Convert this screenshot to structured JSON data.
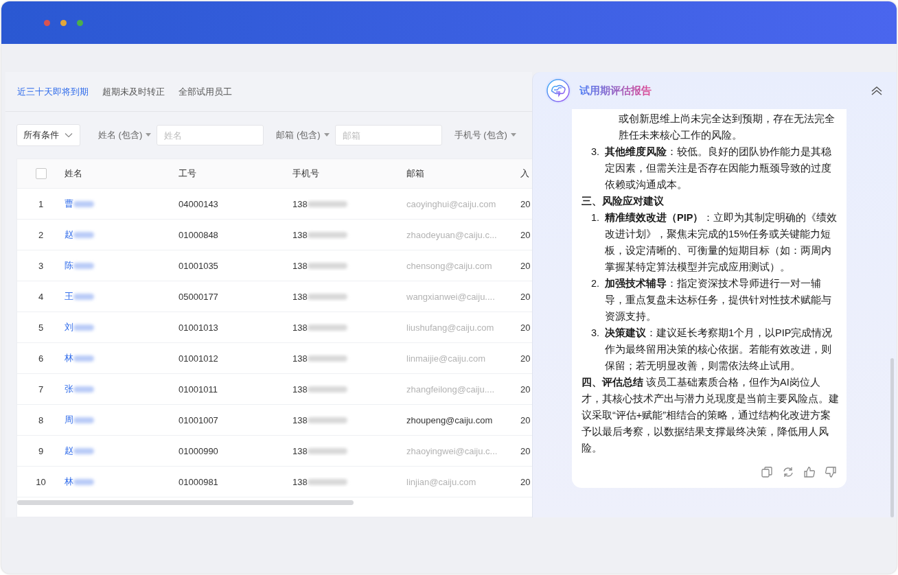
{
  "tabs": [
    {
      "label": "近三十天即将到期",
      "selected": true
    },
    {
      "label": "超期未及时转正",
      "selected": false
    },
    {
      "label": "全部试用员工",
      "selected": false
    }
  ],
  "filters": {
    "condition": "所有条件",
    "fields": [
      {
        "label": "姓名 (包含)",
        "placeholder": "姓名"
      },
      {
        "label": "邮箱 (包含)",
        "placeholder": "邮箱"
      },
      {
        "label": "手机号 (包含)"
      }
    ]
  },
  "table": {
    "select_all_checked": false,
    "columns": [
      "姓名",
      "工号",
      "手机号",
      "邮箱",
      "入"
    ],
    "rows": [
      {
        "index": "1",
        "name": "曹",
        "name_masked": true,
        "id": "04000143",
        "phone": "138",
        "phone_masked": true,
        "email": "caoyinghui@caiju.com",
        "email_masked": true,
        "column_5": "20"
      },
      {
        "index": "2",
        "name": "赵",
        "name_masked": true,
        "id": "01000848",
        "phone": "138",
        "phone_masked": true,
        "email": "zhaodeyuan@caiju.c...",
        "email_masked": true,
        "column_5": "20"
      },
      {
        "index": "3",
        "name": "陈",
        "name_masked": true,
        "id": "01001035",
        "phone": "138",
        "phone_masked": true,
        "email": "chensong@caiju.com",
        "email_masked": true,
        "column_5": "20"
      },
      {
        "index": "4",
        "name": "王",
        "name_masked": true,
        "id": "05000177",
        "phone": "138",
        "phone_masked": true,
        "email": "wangxianwei@caiju....",
        "email_masked": true,
        "column_5": "20"
      },
      {
        "index": "5",
        "name": "刘",
        "name_masked": true,
        "id": "01001013",
        "phone": "138",
        "phone_masked": true,
        "email": "liushufang@caiju.com",
        "email_masked": true,
        "column_5": "20"
      },
      {
        "index": "6",
        "name": "林",
        "name_masked": true,
        "id": "01001012",
        "phone": "138",
        "phone_masked": true,
        "email": "linmaijie@caiju.com",
        "email_masked": true,
        "column_5": "20"
      },
      {
        "index": "7",
        "name": "张",
        "name_masked": true,
        "id": "01001011",
        "phone": "138",
        "phone_masked": true,
        "email": "zhangfeilong@caiju....",
        "email_masked": true,
        "column_5": "20"
      },
      {
        "index": "8",
        "name": "周",
        "name_masked": true,
        "id": "01001007",
        "phone": "138",
        "phone_masked": true,
        "email": "zhoupeng@caiju.com",
        "email_masked": false,
        "column_5": "20"
      },
      {
        "index": "9",
        "name": "赵",
        "name_masked": true,
        "id": "01000990",
        "phone": "138",
        "phone_masked": true,
        "email": "zhaoyingwei@caiju.c...",
        "email_masked": true,
        "column_5": "20"
      },
      {
        "index": "10",
        "name": "林",
        "name_masked": true,
        "id": "01000981",
        "phone": "138",
        "phone_masked": true,
        "email": "linjian@caiju.com",
        "email_masked": true,
        "column_5": "20"
      }
    ]
  },
  "report": {
    "title": "试用期评估报告",
    "blocks": [
      {
        "kind": "continuation",
        "text": "或创新思维上尚未完全达到预期，存在无法完全胜任未来核心工作的风险。"
      },
      {
        "kind": "item",
        "number": "3.",
        "text": "**其他维度风险**：较低。良好的团队协作能力是其稳定因素，但需关注是否存在因能力瓶颈导致的过度依赖或沟通成本。"
      },
      {
        "kind": "heading",
        "text": "三、风险应对建议"
      },
      {
        "kind": "item",
        "number": "1.",
        "text": "**精准绩效改进（PIP）**：立即为其制定明确的《绩效改进计划》，聚焦未完成的15%任务或关键能力短板，设定清晰的、可衡量的短期目标（如：两周内掌握某特定算法模型并完成应用测试）。"
      },
      {
        "kind": "item",
        "number": "2.",
        "text": "**加强技术辅导**：指定资深技术导师进行一对一辅导，重点复盘未达标任务，提供针对性技术赋能与资源支持。"
      },
      {
        "kind": "item",
        "number": "3.",
        "text": "**决策建议**：建议延长考察期1个月，以PIP完成情况作为最终留用决策的核心依据。若能有效改进，则保留；若无明显改善，则需依法终止试用。"
      },
      {
        "kind": "paragraph",
        "text": "**四、评估总结** 该员工基础素质合格，但作为AI岗位人才，其核心技术产出与潜力兑现度是当前主要风险点。建议采取“评估+赋能”相结合的策略，通过结构化改进方案予以最后考察，以数据结果支撑最终决策，降低用人风险。"
      }
    ]
  }
}
